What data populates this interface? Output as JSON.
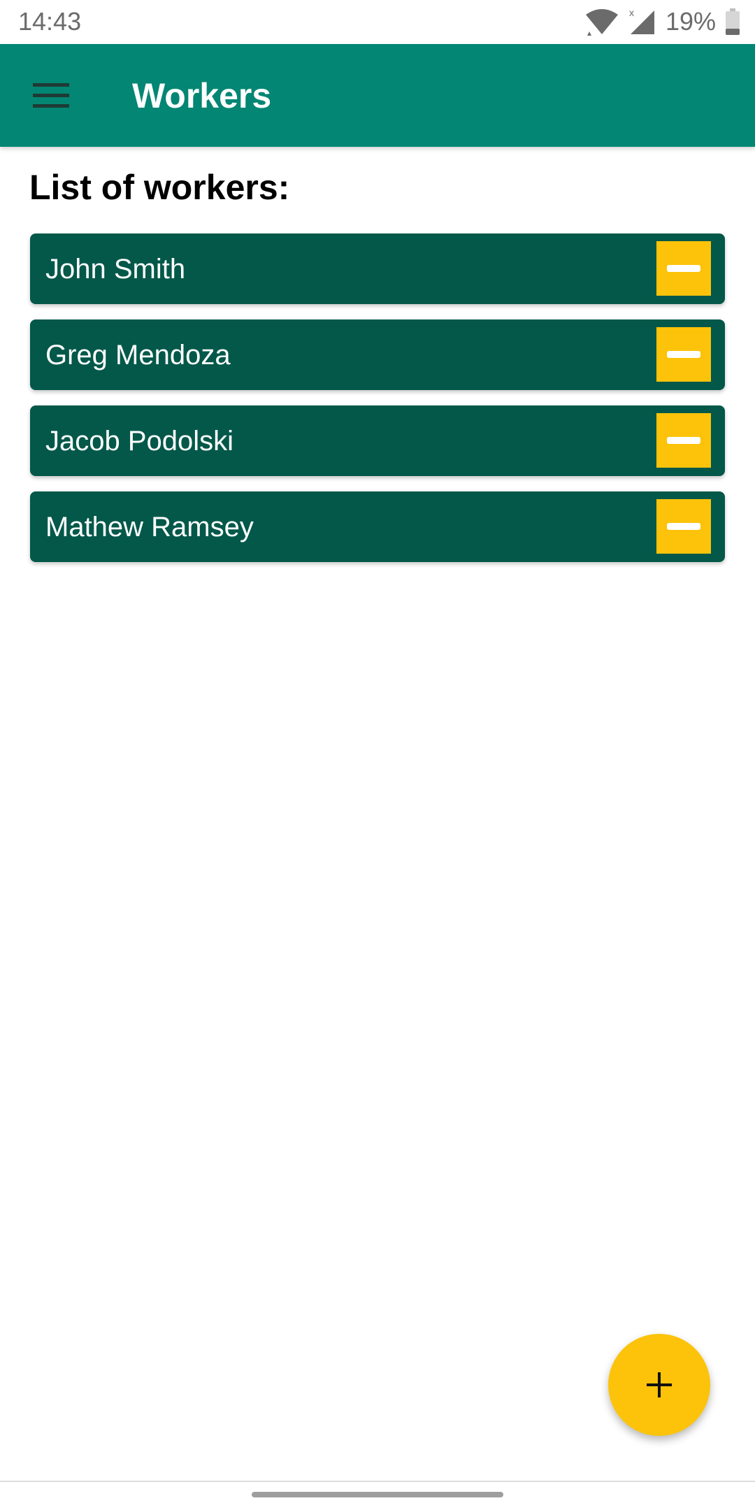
{
  "status_bar": {
    "time": "14:43",
    "battery_text": "19%",
    "icons": [
      "wifi-icon",
      "signal-icon",
      "battery-icon"
    ]
  },
  "app_bar": {
    "title": "Workers",
    "menu_icon": "hamburger-menu-icon",
    "color": "#038673"
  },
  "main": {
    "section_title": "List of workers:",
    "workers": [
      {
        "name": "John Smith"
      },
      {
        "name": "Greg Mendoza"
      },
      {
        "name": "Jacob Podolski"
      },
      {
        "name": "Mathew Ramsey"
      }
    ],
    "row_color": "#035849",
    "remove_icon": "minus-icon",
    "accent_color": "#fcc30a"
  },
  "fab": {
    "icon": "plus-icon"
  }
}
